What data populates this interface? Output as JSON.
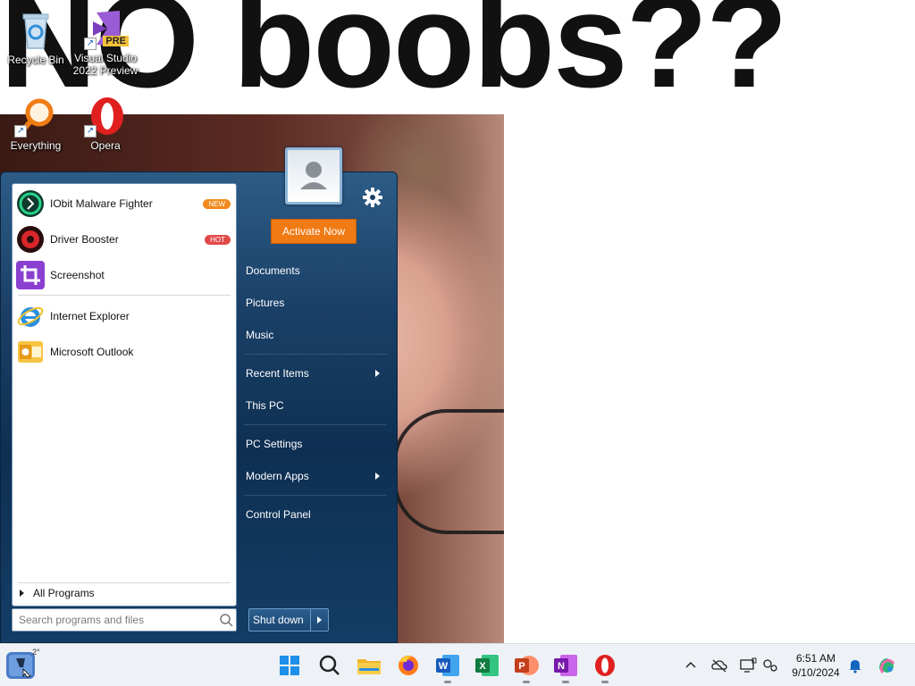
{
  "wallpaper": {
    "text": "NO boobs??"
  },
  "desktop": {
    "icons": [
      {
        "label": "Recycle Bin",
        "icon": "recycle-bin-icon"
      },
      {
        "label": "Visual Studio 2022 Preview",
        "icon": "visual-studio-icon",
        "badge": "PRE"
      },
      {
        "label": "Everything",
        "icon": "everything-search-icon"
      },
      {
        "label": "Opera",
        "icon": "opera-icon"
      }
    ]
  },
  "start_menu": {
    "programs": [
      {
        "label": "IObit Malware Fighter",
        "badge": "NEW",
        "badge_color": "#f08a1c"
      },
      {
        "label": "Driver Booster",
        "badge": "HOT",
        "badge_color": "#e24a4a"
      },
      {
        "label": "Screenshot"
      },
      {
        "label": "Internet Explorer"
      },
      {
        "label": "Microsoft Outlook"
      }
    ],
    "all_programs": "All Programs",
    "search_placeholder": "Search programs and files",
    "activate_button": "Activate Now",
    "right_links": [
      {
        "label": "Documents"
      },
      {
        "label": "Pictures"
      },
      {
        "label": "Music"
      },
      {
        "label": "Recent Items",
        "submenu": true
      },
      {
        "label": "This PC"
      },
      {
        "label": "PC Settings"
      },
      {
        "label": "Modern Apps",
        "submenu": true
      },
      {
        "label": "Control Panel"
      }
    ],
    "shutdown_label": "Shut down"
  },
  "taskbar": {
    "start_weather": "2°",
    "pinned": [
      "windows-start-icon",
      "search-icon",
      "file-explorer-icon",
      "firefox-icon",
      "word-icon",
      "excel-icon",
      "powerpoint-icon",
      "onenote-icon",
      "opera-icon"
    ],
    "time": "6:51 AM",
    "date": "9/10/2024"
  }
}
